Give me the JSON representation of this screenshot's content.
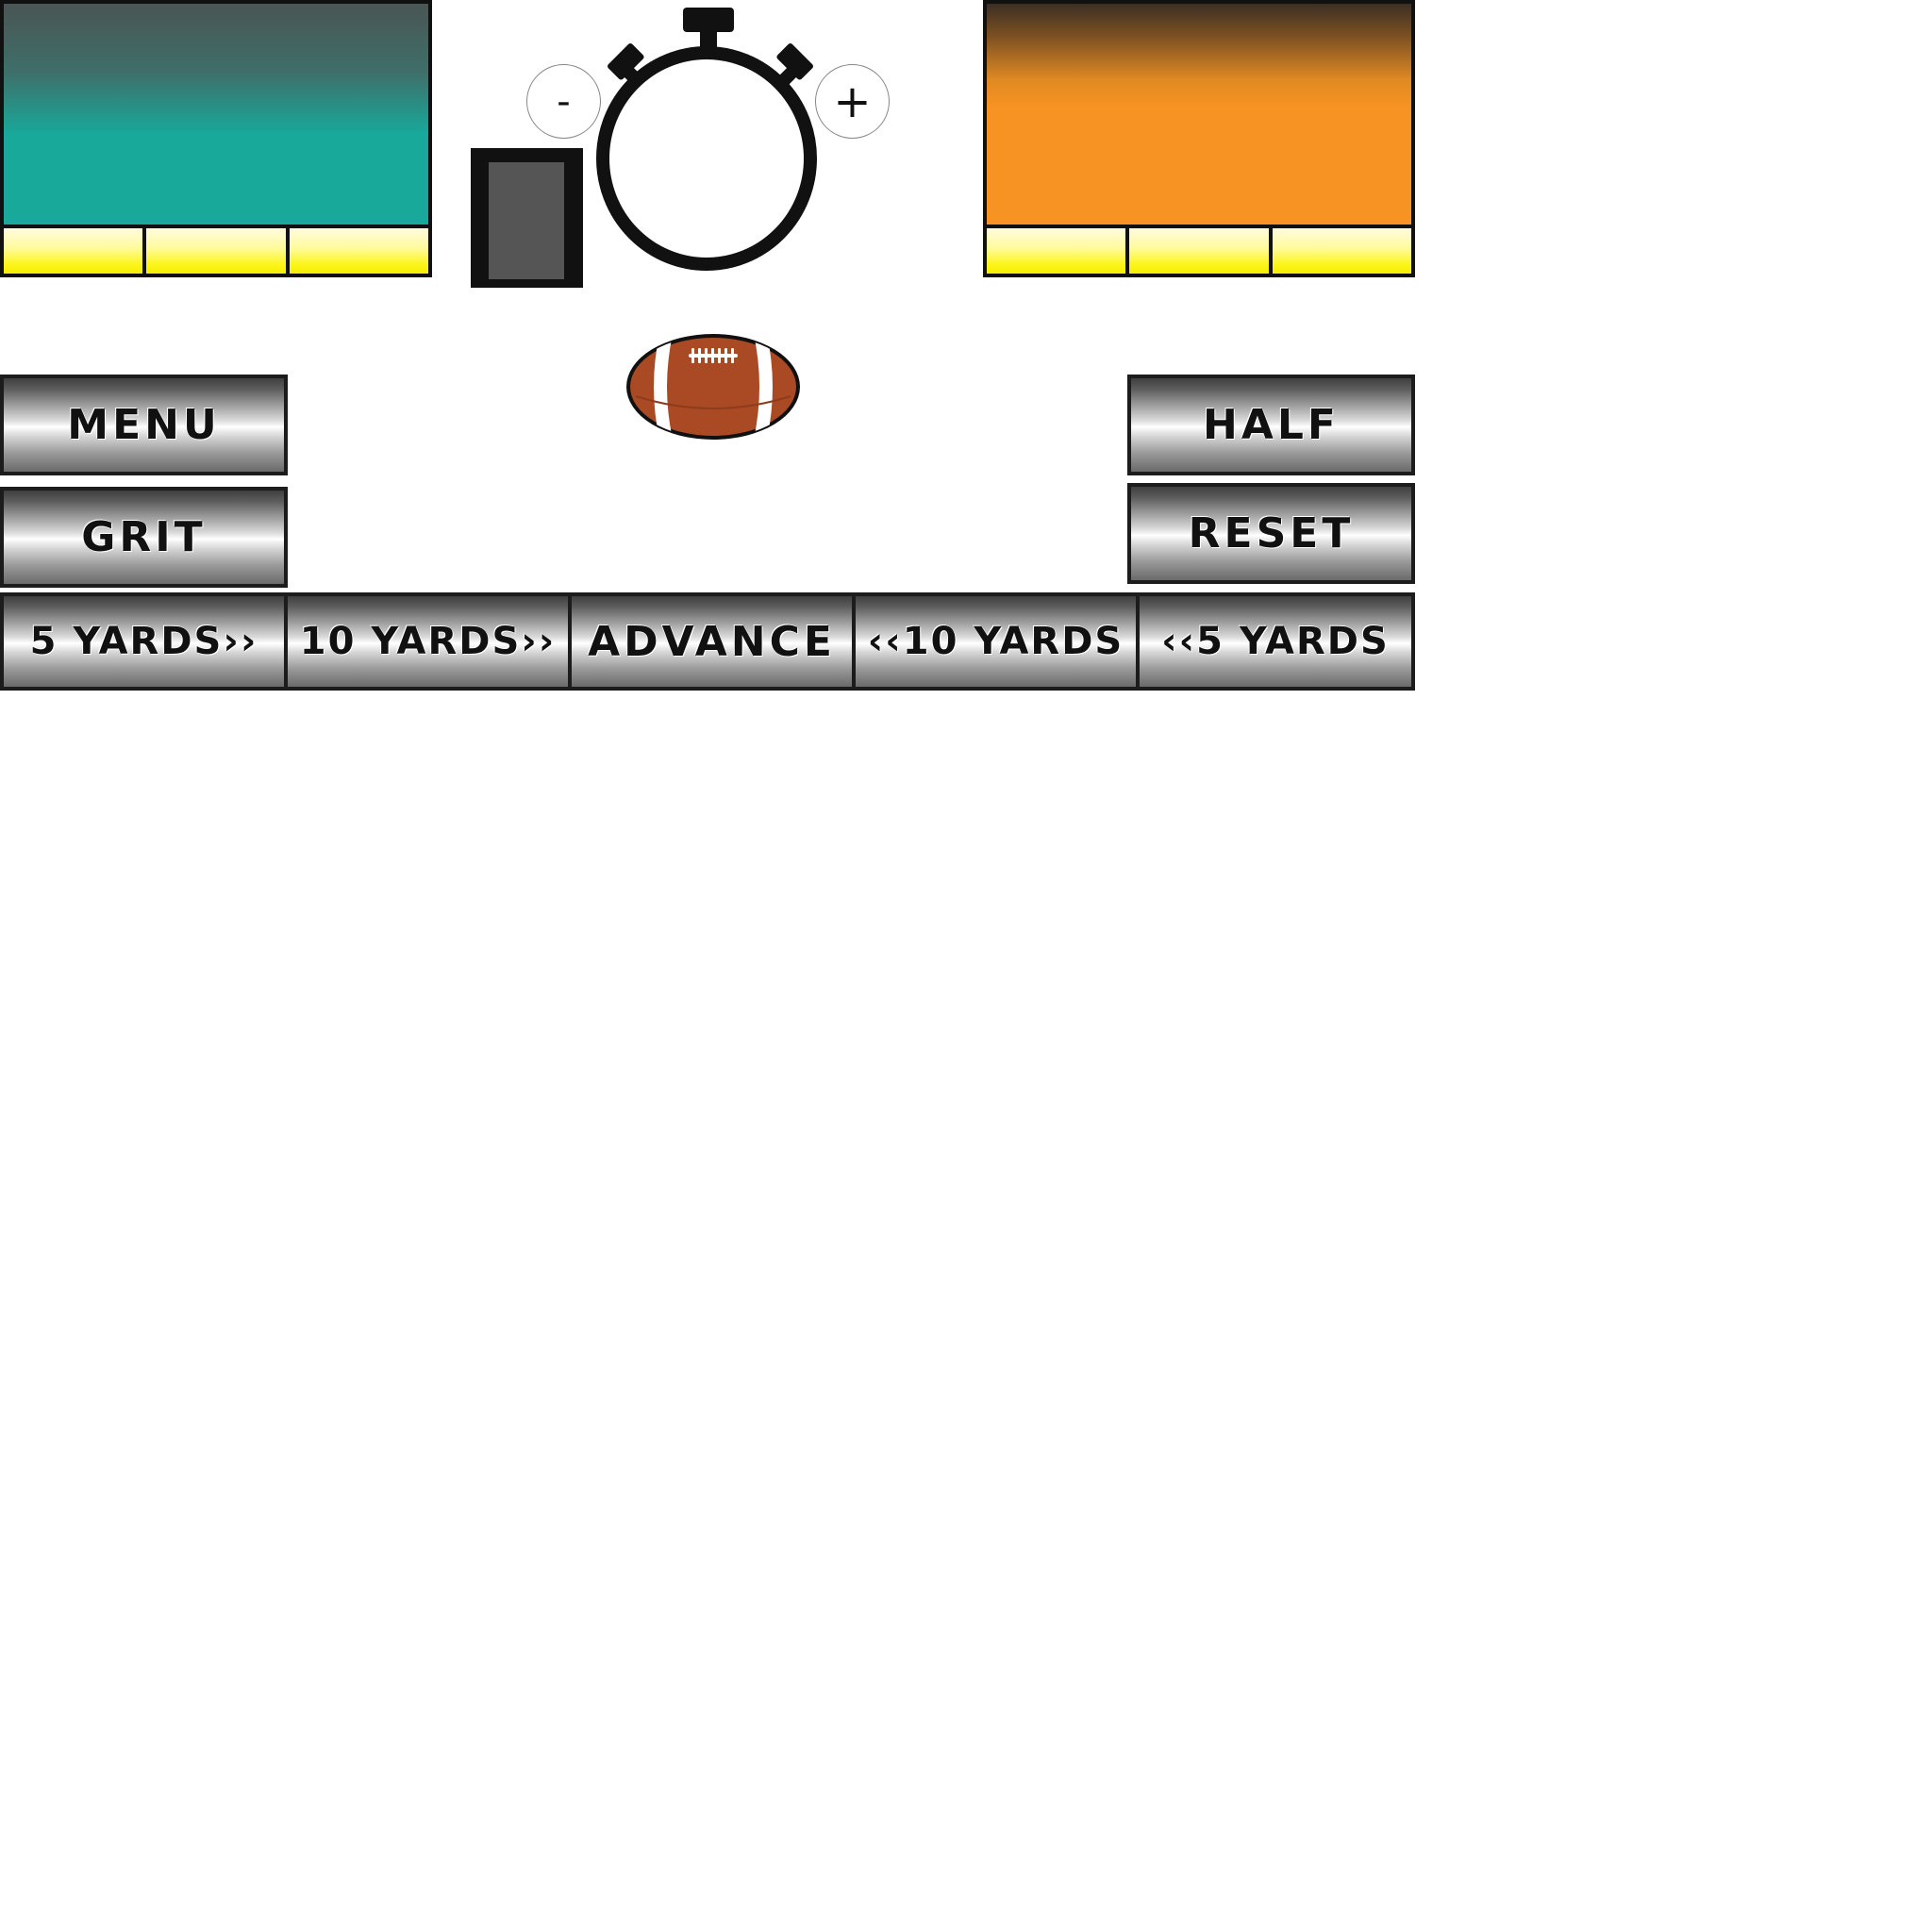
{
  "clock": {
    "minus_label": "-",
    "plus_label": "+"
  },
  "teams": {
    "home": {
      "color": "#18a99a",
      "timeouts_remaining": 3
    },
    "away": {
      "color": "#f69322",
      "timeouts_remaining": 3
    }
  },
  "left_buttons": {
    "menu": "MENU",
    "grit": "GRIT"
  },
  "right_buttons": {
    "half": "HALF",
    "reset": "RESET"
  },
  "bottom_bar": {
    "fwd5": "5 YARDS››",
    "fwd10": "10 YARDS››",
    "advance": "ADVANCE",
    "back10": "‹‹10 YARDS",
    "back5": "‹‹5 YARDS"
  },
  "icons": {
    "stopwatch": "stopwatch-icon",
    "football": "football-icon"
  }
}
